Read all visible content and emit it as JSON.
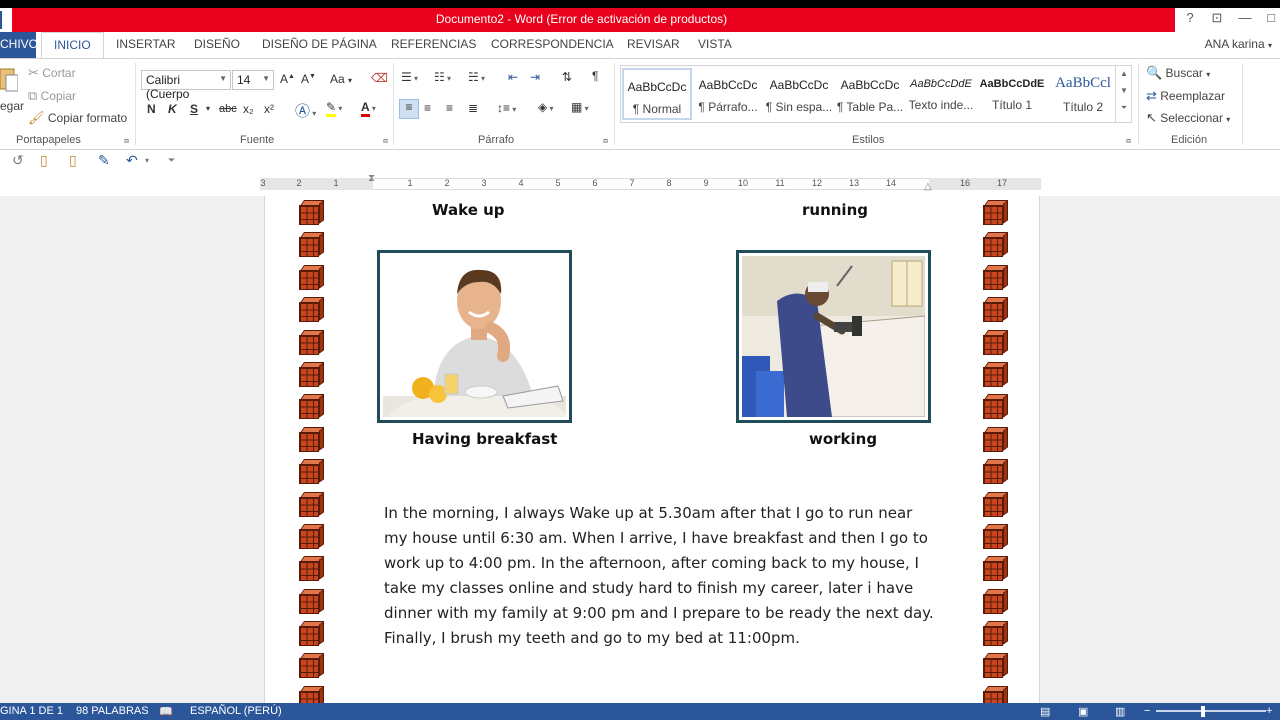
{
  "window": {
    "title": "Documento2 - Word (Error de activación de productos)",
    "help": "?",
    "restore_ribbon": "⊡",
    "minimize": "—",
    "maximize": "□"
  },
  "tabs": {
    "file": "CHIVO",
    "items": [
      "INICIO",
      "INSERTAR",
      "DISEÑO",
      "DISEÑO DE PÁGINA",
      "REFERENCIAS",
      "CORRESPONDENCIA",
      "REVISAR",
      "VISTA"
    ],
    "user": "ANA karina"
  },
  "ribbon": {
    "clipboard": {
      "paste": "egar",
      "cut": "Cortar",
      "copy": "Copiar",
      "format_painter": "Copiar formato",
      "label": "Portapapeles"
    },
    "font": {
      "name": "Calibri (Cuerpo",
      "size": "14",
      "bold": "N",
      "italic": "K",
      "underline": "S",
      "strike": "abc",
      "subscript": "x₂",
      "superscript": "x²",
      "label": "Fuente"
    },
    "paragraph": {
      "label": "Párrafo"
    },
    "styles": {
      "label": "Estilos",
      "items": [
        {
          "sample": "AaBbCcDc",
          "name": "¶ Normal"
        },
        {
          "sample": "AaBbCcDc",
          "name": "¶ Párrafo..."
        },
        {
          "sample": "AaBbCcDc",
          "name": "¶ Sin espa..."
        },
        {
          "sample": "AaBbCcDc",
          "name": "¶ Table Pa..."
        },
        {
          "sample": "AaBbCcDdE",
          "name": "Texto inde..."
        },
        {
          "sample": "AaBbCcDdE",
          "name": "Título 1"
        },
        {
          "sample": "AaBbCcl",
          "name": "Título 2"
        }
      ]
    },
    "editing": {
      "find": "Buscar",
      "replace": "Reemplazar",
      "select": "Seleccionar",
      "label": "Edición"
    }
  },
  "ruler": {
    "numbers": [
      "3",
      "2",
      "1",
      "1",
      "2",
      "3",
      "4",
      "5",
      "6",
      "7",
      "8",
      "9",
      "10",
      "11",
      "12",
      "13",
      "14",
      "16",
      "17"
    ]
  },
  "document": {
    "captions": {
      "wake_up": "Wake up",
      "running": "running",
      "breakfast": "Having breakfast",
      "working": "working"
    },
    "paragraph": [
      " In the morning, I always Wake up at 5.30am after that I go to run near",
      "my house until 6:30 am. When I arrive, I have breakfast and then I go to",
      "work up to 4:00 pm. In the afternoon, after coming back to my house, I",
      "take my classes online and study hard to finish my career, later i have",
      "dinner with my family at 9:00 pm and I prepare to be ready the next day.",
      "Finally, I brush my teeth and go to my bed at 11:00pm."
    ]
  },
  "statusbar": {
    "page": "GINA 1 DE 1",
    "words": "98 PALABRAS",
    "language": "ESPAÑOL (PERÚ)"
  },
  "colors": {
    "title_red": "#e8001c",
    "word_blue": "#2b579a",
    "brick": "#c8461e",
    "photo_border": "#1f4e5a"
  }
}
